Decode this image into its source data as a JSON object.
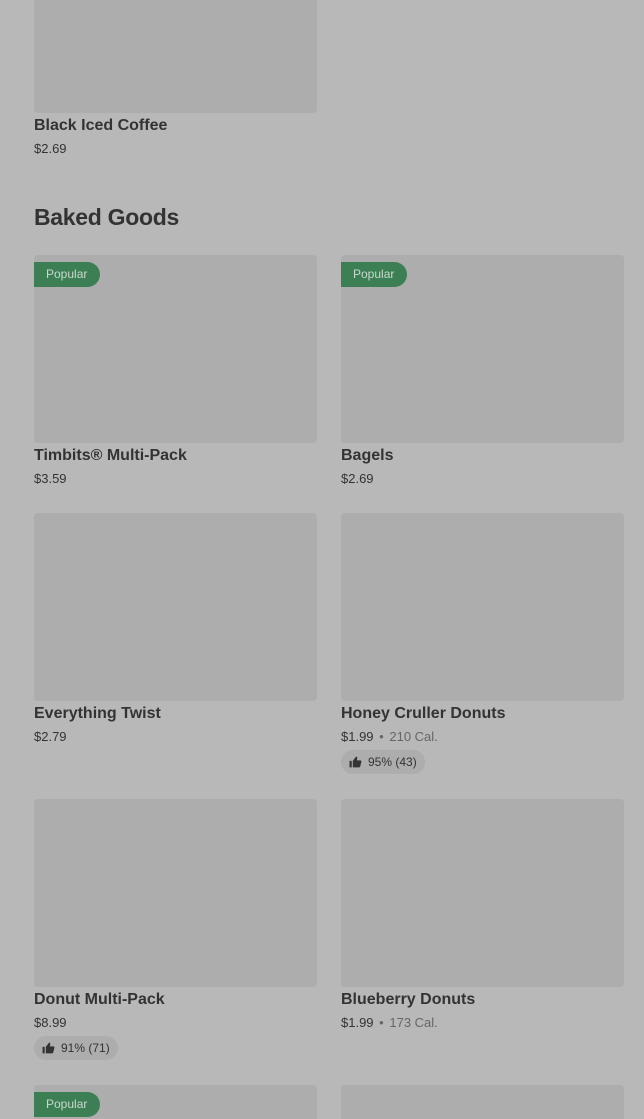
{
  "top_item": {
    "name": "Black Iced Coffee",
    "price": "$2.69"
  },
  "section": {
    "title": "Baked Goods"
  },
  "items": [
    {
      "name": "Timbits® Multi-Pack",
      "price": "$3.59",
      "badge": "Popular"
    },
    {
      "name": "Bagels",
      "price": "$2.69",
      "badge": "Popular"
    },
    {
      "name": "Everything Twist",
      "price": "$2.79"
    },
    {
      "name": "Honey Cruller Donuts",
      "price": "$1.99",
      "sep": "•",
      "calories": "210 Cal.",
      "rating": "95% (43)"
    },
    {
      "name": "Donut Multi-Pack",
      "price": "$8.99",
      "rating": "91% (71)"
    },
    {
      "name": "Blueberry Donuts",
      "price": "$1.99",
      "sep": "•",
      "calories": "173 Cal."
    },
    {
      "badge": "Popular"
    },
    {}
  ],
  "icons": {
    "rating": "thumbs-up-icon"
  },
  "colors": {
    "badge_bg": "#3d7f55",
    "background": "#b8b8b8",
    "image_placeholder": "#adadad"
  }
}
